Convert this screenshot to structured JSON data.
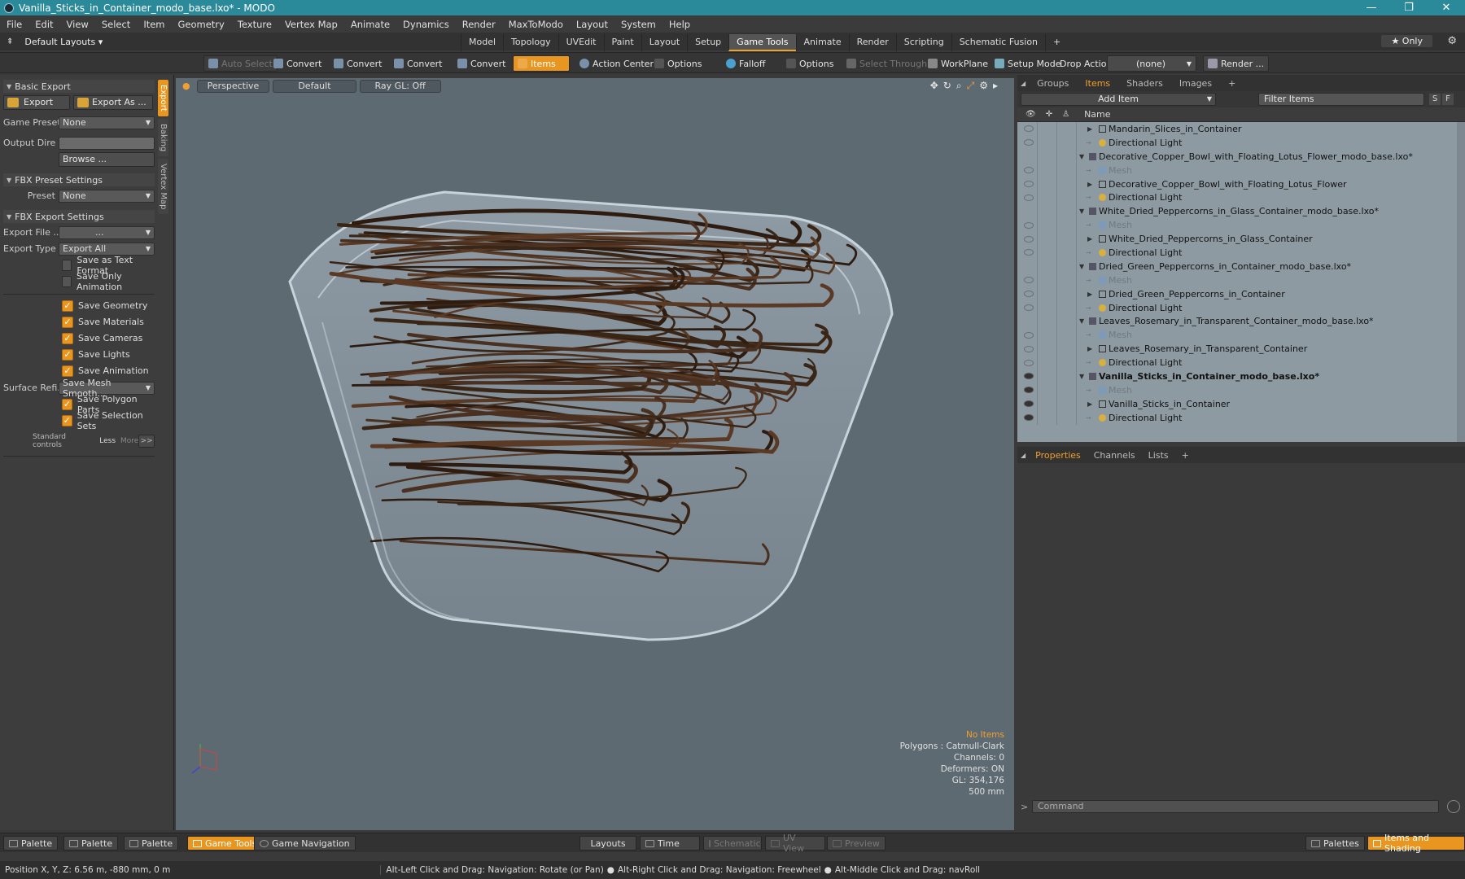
{
  "window": {
    "title": "Vanilla_Sticks_in_Container_modo_base.lxo* - MODO",
    "controls": [
      "—",
      "❐",
      "✕"
    ]
  },
  "menu": [
    "File",
    "Edit",
    "View",
    "Select",
    "Item",
    "Geometry",
    "Texture",
    "Vertex Map",
    "Animate",
    "Dynamics",
    "Render",
    "MaxToModo",
    "Layout",
    "System",
    "Help"
  ],
  "layout_bar": {
    "default_layouts": "Default Layouts ▾",
    "tabs": [
      "Model",
      "Topology",
      "UVEdit",
      "Paint",
      "Layout",
      "Setup",
      "Game Tools",
      "Animate",
      "Render",
      "Scripting",
      "Schematic Fusion",
      "+"
    ],
    "active_tab": "Game Tools",
    "only": "★  Only"
  },
  "toolbar": {
    "auto_select": "Auto Select",
    "convert": "Convert",
    "items": "Items",
    "action_center": "Action Center",
    "options": "Options",
    "falloff": "Falloff",
    "select_through": "Select Through",
    "workplane": "WorkPlane",
    "setup_mode": "Setup Mode",
    "drop_action": "Drop Action",
    "drop_value": "(none)",
    "render": "Render ..."
  },
  "left_panel": {
    "vtabs": [
      "Export",
      "Baking",
      "Vertex Map"
    ],
    "basic_export": "Basic Export",
    "export": "Export",
    "export_as": "Export As ...",
    "game_preset_label": "Game Preset",
    "game_preset_value": "None",
    "output_dir_label": "Output Dire ...",
    "browse": "Browse ...",
    "fbx_preset_settings": "FBX Preset Settings",
    "preset_label": "Preset",
    "preset_value": "None",
    "fbx_export_settings": "FBX Export Settings",
    "export_file_label": "Export File   ...",
    "export_file_value": "...",
    "export_type_label": "Export Type",
    "export_type_value": "Export All",
    "checks": [
      {
        "label": "Save as Text Format",
        "on": false
      },
      {
        "label": "Save Only Animation",
        "on": false
      },
      {
        "label": "Save Geometry",
        "on": true
      },
      {
        "label": "Save Materials",
        "on": true
      },
      {
        "label": "Save Cameras",
        "on": true
      },
      {
        "label": "Save Lights",
        "on": true
      },
      {
        "label": "Save Animation",
        "on": true
      }
    ],
    "surface_label": "Surface Refi...",
    "surface_value": "Save Mesh Smooth...",
    "checks2": [
      {
        "label": "Save Polygon Parts",
        "on": true
      },
      {
        "label": "Save Selection Sets",
        "on": true
      }
    ],
    "standard_controls": "Standard controls",
    "less": "Less",
    "more": "More",
    "expand": ">>"
  },
  "viewport": {
    "perspective": "Perspective",
    "default": "Default",
    "raygl": "Ray GL: Off",
    "stats": {
      "no_items": "No Items",
      "polygons": "Polygons : Catmull-Clark",
      "channels": "Channels: 0",
      "deformers": "Deformers: ON",
      "gl": "GL: 354,176",
      "scale": "500 mm"
    },
    "axis_y": "Y"
  },
  "right_panel": {
    "tabs": [
      "Groups",
      "Items",
      "Shaders",
      "Images",
      "+"
    ],
    "active_tab": "Items",
    "add_item": "Add Item",
    "filter_items": "Filter Items",
    "s_btn": "S",
    "f_btn": "F",
    "name_col": "Name",
    "items": [
      {
        "text": "Mandarin_Slices_in_Container",
        "indent": 1,
        "kind": "mesh-item",
        "tri": "▶",
        "eye": "light"
      },
      {
        "text": "Directional Light",
        "indent": 1,
        "kind": "light",
        "tri": "",
        "eye": "light"
      },
      {
        "text": "Decorative_Copper_Bowl_with_Floating_Lotus_Flower_modo_base.lxo*",
        "indent": 0,
        "kind": "scene",
        "tri": "▼",
        "eye": "none"
      },
      {
        "text": "Mesh",
        "indent": 1,
        "kind": "mesh",
        "tri": "",
        "eye": "light",
        "gray": true
      },
      {
        "text": "Decorative_Copper_Bowl_with_Floating_Lotus_Flower",
        "indent": 1,
        "kind": "mesh-item",
        "tri": "▶",
        "eye": "light"
      },
      {
        "text": "Directional Light",
        "indent": 1,
        "kind": "light",
        "tri": "",
        "eye": "light"
      },
      {
        "text": "White_Dried_Peppercorns_in_Glass_Container_modo_base.lxo*",
        "indent": 0,
        "kind": "scene",
        "tri": "▼",
        "eye": "none"
      },
      {
        "text": "Mesh",
        "indent": 1,
        "kind": "mesh",
        "tri": "",
        "eye": "light",
        "gray": true
      },
      {
        "text": "White_Dried_Peppercorns_in_Glass_Container",
        "indent": 1,
        "kind": "mesh-item",
        "tri": "▶",
        "eye": "light"
      },
      {
        "text": "Directional Light",
        "indent": 1,
        "kind": "light",
        "tri": "",
        "eye": "light"
      },
      {
        "text": "Dried_Green_Peppercorns_in_Container_modo_base.lxo*",
        "indent": 0,
        "kind": "scene",
        "tri": "▼",
        "eye": "none"
      },
      {
        "text": "Mesh",
        "indent": 1,
        "kind": "mesh",
        "tri": "",
        "eye": "light",
        "gray": true
      },
      {
        "text": "Dried_Green_Peppercorns_in_Container",
        "indent": 1,
        "kind": "mesh-item",
        "tri": "▶",
        "eye": "light"
      },
      {
        "text": "Directional Light",
        "indent": 1,
        "kind": "light",
        "tri": "",
        "eye": "light"
      },
      {
        "text": "Leaves_Rosemary_in_Transparent_Container_modo_base.lxo*",
        "indent": 0,
        "kind": "scene",
        "tri": "▼",
        "eye": "none"
      },
      {
        "text": "Mesh",
        "indent": 1,
        "kind": "mesh",
        "tri": "",
        "eye": "light",
        "gray": true
      },
      {
        "text": "Leaves_Rosemary_in_Transparent_Container",
        "indent": 1,
        "kind": "mesh-item",
        "tri": "▶",
        "eye": "light"
      },
      {
        "text": "Directional Light",
        "indent": 1,
        "kind": "light",
        "tri": "",
        "eye": "light"
      },
      {
        "text": "Vanilla_Sticks_in_Container_modo_base.lxo*",
        "indent": 0,
        "kind": "scene",
        "tri": "▼",
        "eye": "dark",
        "bold": true
      },
      {
        "text": "Mesh",
        "indent": 1,
        "kind": "mesh",
        "tri": "",
        "eye": "dark",
        "gray": true
      },
      {
        "text": "Vanilla_Sticks_in_Container",
        "indent": 1,
        "kind": "mesh-item",
        "tri": "▶",
        "eye": "dark"
      },
      {
        "text": "Directional Light",
        "indent": 1,
        "kind": "light",
        "tri": "",
        "eye": "dark"
      }
    ],
    "props_tabs": [
      "Properties",
      "Channels",
      "Lists",
      "+"
    ],
    "props_active": "Properties",
    "command": "Command"
  },
  "bottom_bar": {
    "palette": "Palette",
    "game_tools": "Game Tools",
    "game_navigation": "Game Navigation",
    "layouts": "Layouts",
    "time": "Time",
    "schematic": "Schematic",
    "uv_view": "UV View",
    "preview": "Preview",
    "palettes": "Palettes",
    "items_and_shading": "Items and Shading"
  },
  "status": {
    "position": "Position X, Y, Z:   6.56 m, -880 mm, 0 m",
    "hint1": "Alt-Left Click and Drag: Navigation: Rotate (or Pan)",
    "hint2": "Alt-Right Click and Drag: Navigation: Freewheel",
    "hint3": "Alt-Middle Click and Drag: navRoll"
  },
  "colors": {
    "accent": "#e8961f",
    "title": "#2b8a9a",
    "viewport": "#5e6a72",
    "list_bg": "#8e9aa2"
  }
}
